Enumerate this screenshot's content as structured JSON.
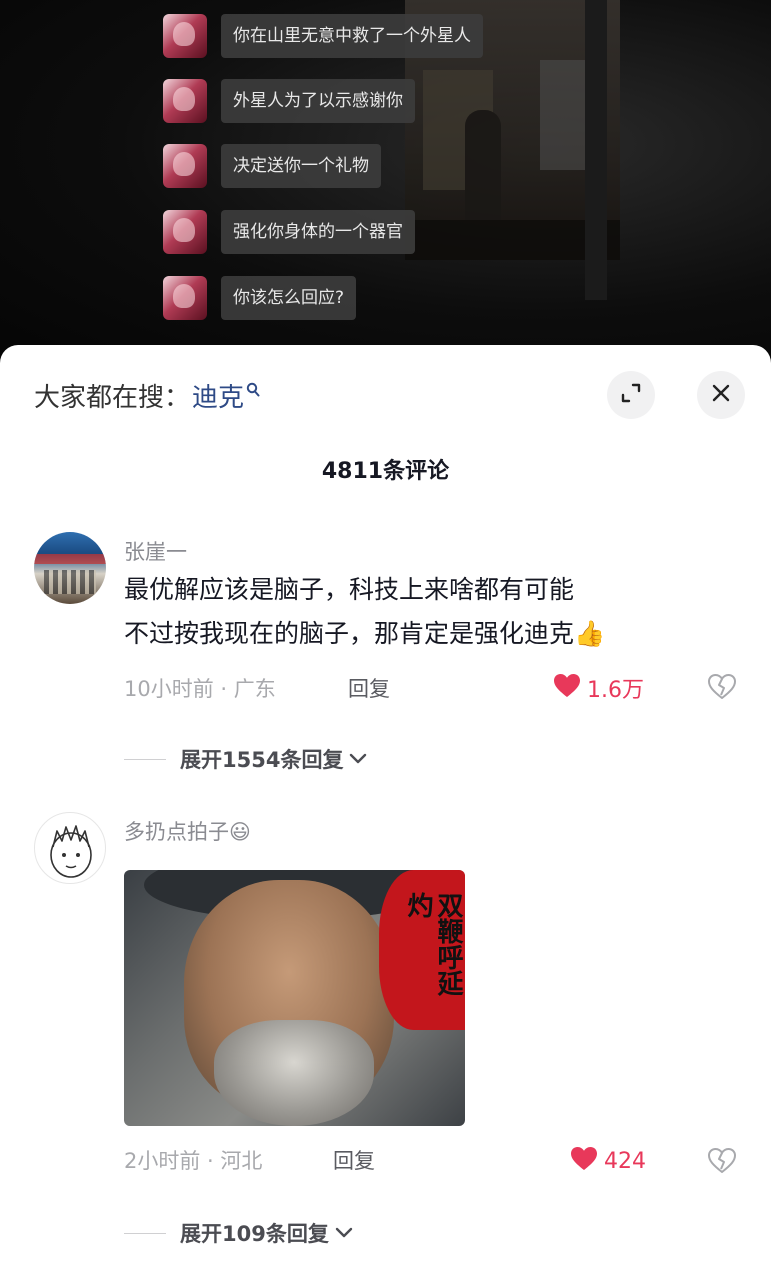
{
  "video": {
    "messages": [
      "你在山里无意中救了一个外星人",
      "外星人为了以示感谢你",
      "决定送你一个礼物",
      "强化你身体的一个器官",
      "你该怎么回应?"
    ]
  },
  "sheet": {
    "search_prefix": "大家都在搜：",
    "search_term": "迪克",
    "comment_count_title": "4811条评论",
    "expand_icon": "expand-icon",
    "close_icon": "close-icon"
  },
  "comments": [
    {
      "username": "张崖一",
      "line1": "最优解应该是脑子，科技上来啥都有可能",
      "line2": "不过按我现在的脑子，那肯定是强化迪克",
      "emoji": "👍",
      "meta": "10小时前 · 广东",
      "reply_label": "回复",
      "likes": "1.6万",
      "expand_replies": "展开1554条回复"
    },
    {
      "username": "多扔点拍子",
      "emoji": "😃",
      "image_text": "双鞭呼延灼",
      "meta": "2小时前 · 河北",
      "reply_label": "回复",
      "likes": "424",
      "expand_replies": "展开109条回复"
    }
  ],
  "colors": {
    "like_red": "#e8385a",
    "search_blue": "#2e4a86",
    "text_dark": "#161823",
    "text_gray": "#8a8b91"
  }
}
